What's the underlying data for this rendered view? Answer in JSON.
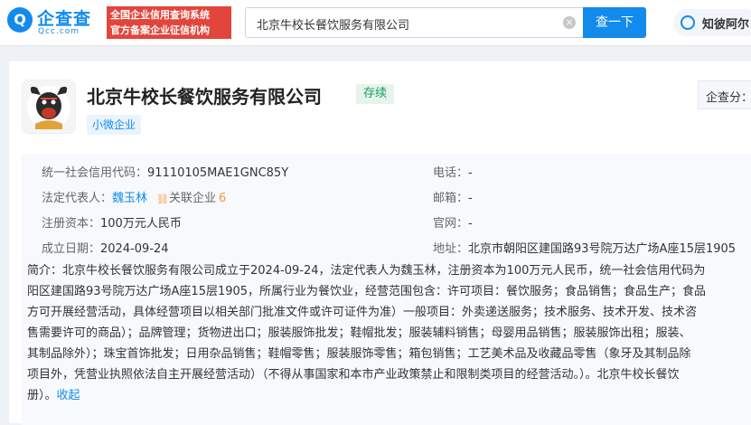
{
  "header": {
    "logo_text": "企查查",
    "logo_mark": "Q",
    "logo_sub": "Qcc.com",
    "slogan_line1": "全国企业信用查询系统",
    "slogan_line2": "官方备案企业征信机构",
    "search_value": "北京牛校长餐饮服务有限公司",
    "search_button": "查一下",
    "ai_label": "知彼阿尔"
  },
  "company": {
    "name": "北京牛校长餐饮服务有限公司",
    "status": "存续",
    "size_tag": "小微企业",
    "score_label": "企查分："
  },
  "info": {
    "credit_code_label": "统一社会信用代码：",
    "credit_code": "91110105MAE1GNC85Y",
    "legal_rep_label": "法定代表人：",
    "legal_rep": "魏玉林",
    "related_label": "关联企业",
    "related_count": "6",
    "capital_label": "注册资本：",
    "capital": "100万元人民币",
    "founded_label": "成立日期：",
    "founded": "2024-09-24",
    "phone_label": "电话：",
    "phone": "-",
    "email_label": "邮箱：",
    "email": "-",
    "website_label": "官网：",
    "website": "-",
    "address_label": "地址：",
    "address": "北京市朝阳区建国路93号院万达广场A座15层1905"
  },
  "intro": {
    "lines": [
      "简介：北京牛校长餐饮服务有限公司成立于2024-09-24，法定代表人为魏玉林，注册资本为100万元人民币，统一社会信用代码为",
      "阳区建国路93号院万达广场A座15层1905，所属行业为餐饮业，经营范围包含：许可项目：餐饮服务；食品销售；食品生产；食品",
      "方可开展经营活动，具体经营项目以相关部门批准文件或许可证件为准）一般项目：外卖递送服务；技术服务、技术开发、技术咨",
      "售需要许可的商品）；品牌管理；货物进出口；服装服饰批发；鞋帽批发；服装辅料销售；母婴用品销售；服装服饰出租；服装、",
      "其制品除外）；珠宝首饰批发；日用杂品销售；鞋帽零售；服装服饰零售；箱包销售；工艺美术品及收藏品零售（象牙及其制品除",
      "项目外，凭营业执照依法自主开展经营活动）（不得从事国家和本市产业政策禁止和限制类项目的经营活动。）。北京牛校长餐饮"
    ],
    "last_line": "册）。",
    "collapse": "收起"
  },
  "colors": {
    "brand": "#128bed",
    "status": "#12a05c",
    "slogan_bg": "#e2453c"
  }
}
